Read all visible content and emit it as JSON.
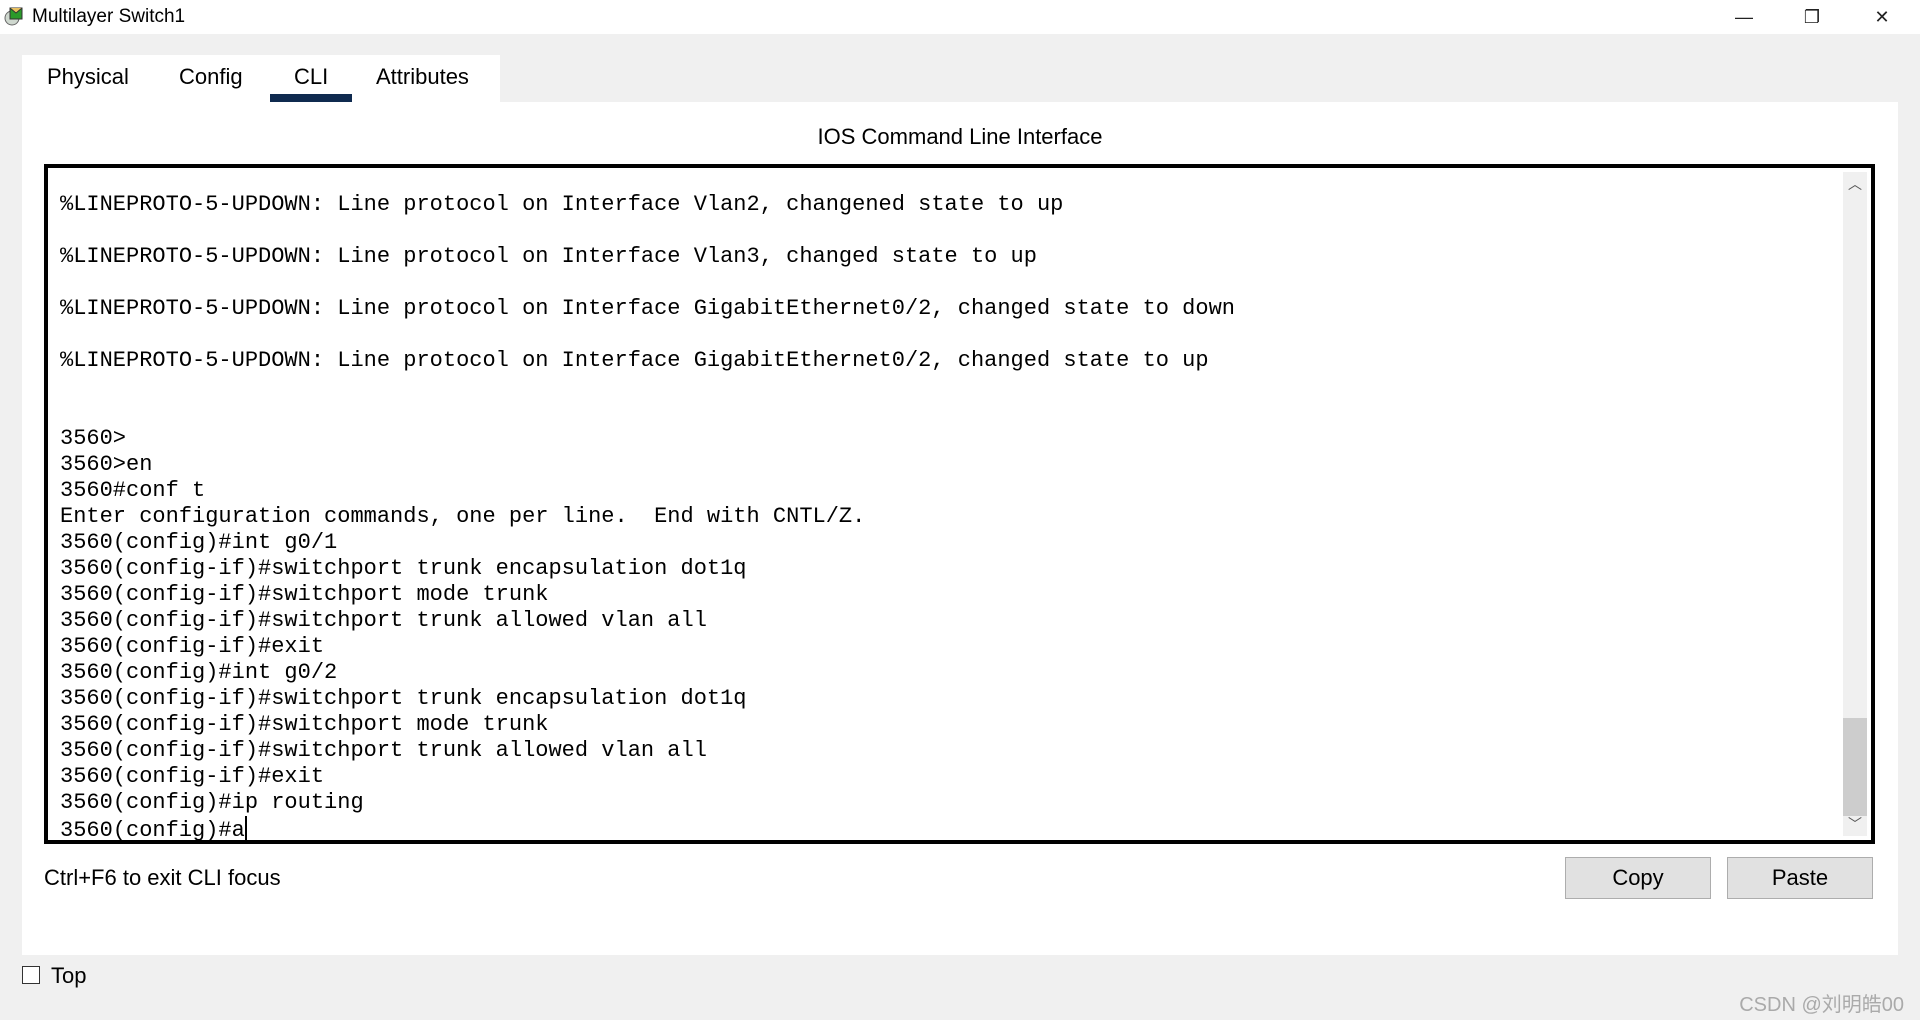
{
  "window": {
    "title": "Multilayer Switch1",
    "controls": {
      "minimize": "—",
      "restore": "❐",
      "close": "✕"
    }
  },
  "tabs": [
    {
      "label": "Physical",
      "active": false
    },
    {
      "label": "Config",
      "active": false
    },
    {
      "label": "CLI",
      "active": true
    },
    {
      "label": "Attributes",
      "active": false
    }
  ],
  "accent_color": "#0f2a4f",
  "cli": {
    "heading": "IOS Command Line Interface",
    "lines": [
      "%LINEPROTO-5-UPDOWN: Line protocol on Interface Vlan2, changened state to up",
      "",
      "%LINEPROTO-5-UPDOWN: Line protocol on Interface Vlan3, changed state to up",
      "",
      "%LINEPROTO-5-UPDOWN: Line protocol on Interface GigabitEthernet0/2, changed state to down",
      "",
      "%LINEPROTO-5-UPDOWN: Line protocol on Interface GigabitEthernet0/2, changed state to up",
      "",
      "",
      "3560>",
      "3560>en",
      "3560#conf t",
      "Enter configuration commands, one per line.  End with CNTL/Z.",
      "3560(config)#int g0/1",
      "3560(config-if)#switchport trunk encapsulation dot1q",
      "3560(config-if)#switchport mode trunk",
      "3560(config-if)#switchport trunk allowed vlan all",
      "3560(config-if)#exit",
      "3560(config)#int g0/2",
      "3560(config-if)#switchport trunk encapsulation dot1q",
      "3560(config-if)#switchport mode trunk",
      "3560(config-if)#switchport trunk allowed vlan all",
      "3560(config-if)#exit",
      "3560(config)#ip routing",
      "3560(config)#a"
    ],
    "scroll_position_percent": 100,
    "focus_hint": "Ctrl+F6 to exit CLI focus",
    "copy_label": "Copy",
    "paste_label": "Paste"
  },
  "footer": {
    "top_label": "Top",
    "top_checked": false
  },
  "watermark": "CSDN @刘明皓00"
}
